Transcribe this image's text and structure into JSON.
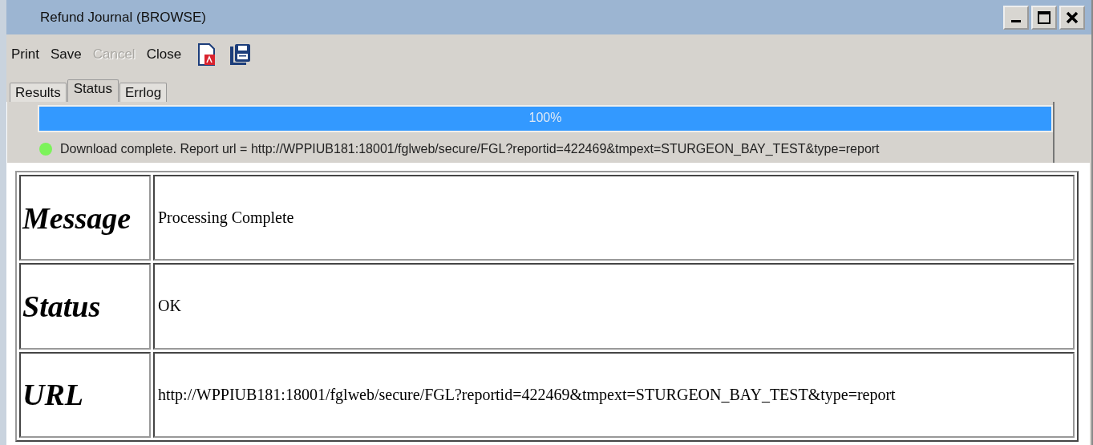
{
  "window": {
    "title": "Refund Journal (BROWSE)"
  },
  "toolbar": [
    {
      "kind": "text",
      "label": "Print",
      "disabled": false
    },
    {
      "kind": "text",
      "label": "Save",
      "disabled": false
    },
    {
      "kind": "text",
      "label": "Cancel",
      "disabled": true
    },
    {
      "kind": "text",
      "label": "Close",
      "disabled": false
    },
    {
      "kind": "pdf",
      "disabled": false
    },
    {
      "kind": "save-copy",
      "disabled": false
    }
  ],
  "tabs": [
    {
      "label": "Results",
      "selected": false
    },
    {
      "label": "Status",
      "selected": true
    },
    {
      "label": "Errlog",
      "selected": false
    }
  ],
  "progress": {
    "level": 1,
    "reading": "100%"
  },
  "status": {
    "ok": true,
    "text": "Download complete. Report url = http://WPPIUB181:18001/fglweb/secure/FGL?reportid=422469&tmpext=STURGEON_BAY_TEST&type=report"
  },
  "table": {
    "rows": [
      {
        "label": "Message",
        "value": "Processing Complete"
      },
      {
        "label": "Status",
        "value": "OK"
      },
      {
        "label": "URL",
        "value": "http://WPPIUB181:18001/fglweb/secure/FGL?reportid=422469&tmpext=STURGEON_BAY_TEST&type=report"
      }
    ]
  }
}
